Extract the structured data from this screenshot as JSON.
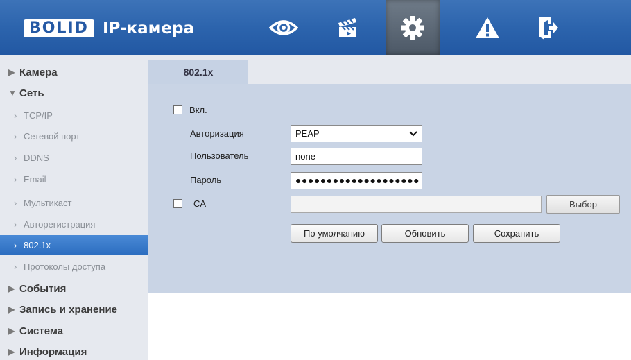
{
  "header": {
    "brand": "BOLID",
    "title": "IP-камера",
    "nav": [
      {
        "icon": "eye-icon",
        "label": "live-view"
      },
      {
        "icon": "clapperboard-icon",
        "label": "playback"
      },
      {
        "icon": "gear-icon",
        "label": "settings",
        "active": true
      },
      {
        "icon": "warning-icon",
        "label": "alarm"
      },
      {
        "icon": "logout-icon",
        "label": "logout"
      }
    ]
  },
  "sidebar": {
    "items": [
      {
        "type": "category",
        "label": "Камера",
        "expanded": false
      },
      {
        "type": "category",
        "label": "Сеть",
        "expanded": true
      },
      {
        "type": "sub",
        "label": "TCP/IP"
      },
      {
        "type": "sub",
        "label": "Сетевой порт"
      },
      {
        "type": "sub",
        "label": "DDNS"
      },
      {
        "type": "sub",
        "label": "Email"
      },
      {
        "type": "sub",
        "label": "Мультикаст"
      },
      {
        "type": "sub",
        "label": "Авторегистрация"
      },
      {
        "type": "sub",
        "label": "802.1x",
        "active": true
      },
      {
        "type": "sub",
        "label": "Протоколы доступа"
      },
      {
        "type": "category",
        "label": "События",
        "expanded": false
      },
      {
        "type": "category",
        "label": "Запись и хранение",
        "expanded": false
      },
      {
        "type": "category",
        "label": "Система",
        "expanded": false
      },
      {
        "type": "category",
        "label": "Информация",
        "expanded": false
      }
    ]
  },
  "tab": {
    "label": "802.1x"
  },
  "form": {
    "enable_label": "Вкл.",
    "enable_checked": false,
    "auth_label": "Авторизация",
    "auth_value": "PEAP",
    "user_label": "Пользователь",
    "user_value": "none",
    "password_label": "Пароль",
    "password_value": "●●●●●●●●●●●●●●●●●●●●",
    "ca_label": "CA",
    "ca_checked": false,
    "ca_path": "",
    "choose_button": "Выбор",
    "default_button": "По умолчанию",
    "refresh_button": "Обновить",
    "save_button": "Сохранить"
  },
  "colors": {
    "header": "#2c64ad",
    "sidebar_bg": "#e6e9ef",
    "panel_bg": "#c9d4e5",
    "active_item": "#2c6ec0"
  }
}
